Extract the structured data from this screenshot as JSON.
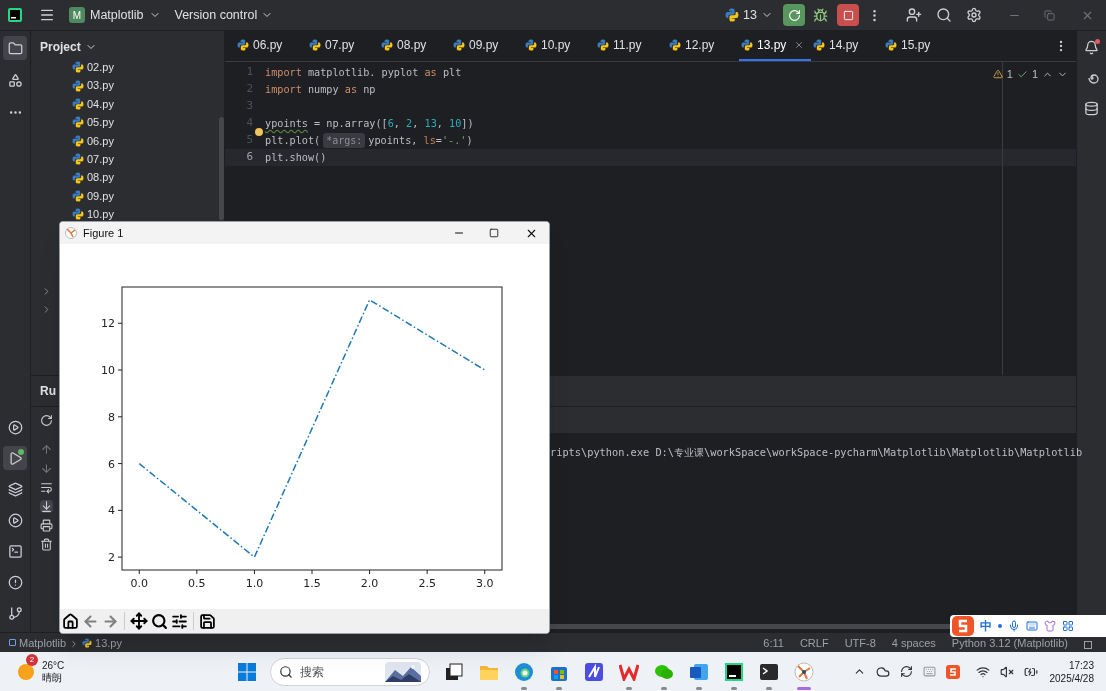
{
  "top_bar": {
    "project_badge": "M",
    "project": "Matplotlib",
    "vcs": "Version control",
    "run_config": "13"
  },
  "left_tools_top": [
    {
      "selected": true
    },
    {
      "selected": false
    },
    {
      "selected": false
    }
  ],
  "left_tools_bottom": [
    {
      "selected": false
    },
    {
      "selected": true
    },
    {
      "selected": false
    },
    {
      "selected": false
    },
    {
      "selected": false
    },
    {
      "selected": false
    },
    {
      "selected": false
    }
  ],
  "project_panel": {
    "title": "Project",
    "files": [
      "02.py",
      "03.py",
      "04.py",
      "05.py",
      "06.py",
      "07.py",
      "08.py",
      "09.py",
      "10.py"
    ]
  },
  "editor_tabs": [
    {
      "label": "06.py",
      "selected": false
    },
    {
      "label": "07.py",
      "selected": false
    },
    {
      "label": "08.py",
      "selected": false
    },
    {
      "label": "09.py",
      "selected": false
    },
    {
      "label": "10.py",
      "selected": false
    },
    {
      "label": "11.py",
      "selected": false
    },
    {
      "label": "12.py",
      "selected": false
    },
    {
      "label": "13.py",
      "selected": true
    },
    {
      "label": "14.py",
      "selected": false
    },
    {
      "label": "15.py",
      "selected": false
    }
  ],
  "editor": {
    "warnings": "1",
    "passes": "1",
    "lines": [
      {
        "number": "1",
        "current": false,
        "tokens": [
          {
            "text": "import",
            "kind": "keyword"
          },
          {
            "text": " matplotlib. pyplot ",
            "kind": "plain"
          },
          {
            "text": "as",
            "kind": "keyword"
          },
          {
            "text": " plt",
            "kind": "plain"
          }
        ]
      },
      {
        "number": "2",
        "current": false,
        "tokens": [
          {
            "text": "import",
            "kind": "keyword"
          },
          {
            "text": " numpy ",
            "kind": "plain"
          },
          {
            "text": "as",
            "kind": "keyword"
          },
          {
            "text": " np",
            "kind": "plain"
          }
        ]
      },
      {
        "number": "3",
        "current": false
      },
      {
        "number": "4",
        "current": false,
        "tokens": [
          {
            "text": "ypoints",
            "kind": "weak_warning"
          },
          {
            "text": " = np.array([",
            "kind": "plain"
          },
          {
            "text": "6",
            "kind": "number"
          },
          {
            "text": ", ",
            "kind": "plain"
          },
          {
            "text": "2",
            "kind": "number"
          },
          {
            "text": ", ",
            "kind": "plain"
          },
          {
            "text": "13",
            "kind": "number"
          },
          {
            "text": ", ",
            "kind": "plain"
          },
          {
            "text": "10",
            "kind": "number"
          },
          {
            "text": "])",
            "kind": "plain"
          }
        ]
      },
      {
        "number": "5",
        "current": false,
        "tokens": [
          {
            "text": "plt.plot(",
            "kind": "plain"
          },
          {
            "text": "*args:",
            "kind": "hint"
          },
          {
            "text": "ypoints, ",
            "kind": "plain"
          },
          {
            "text": "ls",
            "kind": "param"
          },
          {
            "text": "=",
            "kind": "plain"
          },
          {
            "text": "'-.'",
            "kind": "string"
          },
          {
            "text": ")",
            "kind": "plain"
          }
        ]
      },
      {
        "number": "6",
        "current": true,
        "tokens": [
          {
            "text": "plt.show()",
            "kind": "plain"
          }
        ]
      }
    ]
  },
  "run_panel": {
    "title": "Ru",
    "output": "ripts\\python.exe D:\\专业课\\workSpace\\workSpace-pycharm\\Matplotlib\\Matplotlib\\Matplotlib"
  },
  "figure": {
    "title": "Figure 1",
    "chart_data": {
      "type": "line",
      "x": [
        0,
        1,
        2,
        3
      ],
      "series": [
        {
          "color": "#1f77b4",
          "line_style": "dashdot",
          "values": [
            6,
            2,
            13,
            10
          ]
        }
      ],
      "xlim": [
        -0.15,
        3.15
      ],
      "ylim": [
        1.45,
        13.55
      ],
      "xticks": [
        {
          "value": 0,
          "label": "0.0"
        },
        {
          "value": 0.5,
          "label": "0.5"
        },
        {
          "value": 1,
          "label": "1.0"
        },
        {
          "value": 1.5,
          "label": "1.5"
        },
        {
          "value": 2,
          "label": "2.0"
        },
        {
          "value": 2.5,
          "label": "2.5"
        },
        {
          "value": 3,
          "label": "3.0"
        }
      ],
      "yticks": [
        2,
        4,
        6,
        8,
        10,
        12
      ]
    }
  },
  "status_bar": {
    "breadcrumbs": [
      "Matplotlib",
      "13.py"
    ],
    "items": [
      "6:11",
      "CRLF",
      "UTF-8",
      "4 spaces",
      "Python 3.12 (Matplotlib)"
    ]
  },
  "ime_toolbar": {
    "mode": "中"
  },
  "taskbar": {
    "weather": {
      "badge": "2",
      "temperature": "26°C",
      "condition": "晴朗"
    },
    "search_placeholder": "搜索",
    "apps": [
      {
        "running": false,
        "active": false
      },
      {
        "running": false,
        "active": false
      },
      {
        "running": true,
        "active": false
      },
      {
        "running": true,
        "active": false
      },
      {
        "running": false,
        "active": false
      },
      {
        "running": true,
        "active": false
      },
      {
        "running": true,
        "active": false
      },
      {
        "running": true,
        "active": false
      },
      {
        "running": true,
        "active": false
      },
      {
        "running": true,
        "active": false
      },
      {
        "running": true,
        "active": true
      }
    ],
    "time": "17:23",
    "date": "2025/4/28"
  }
}
